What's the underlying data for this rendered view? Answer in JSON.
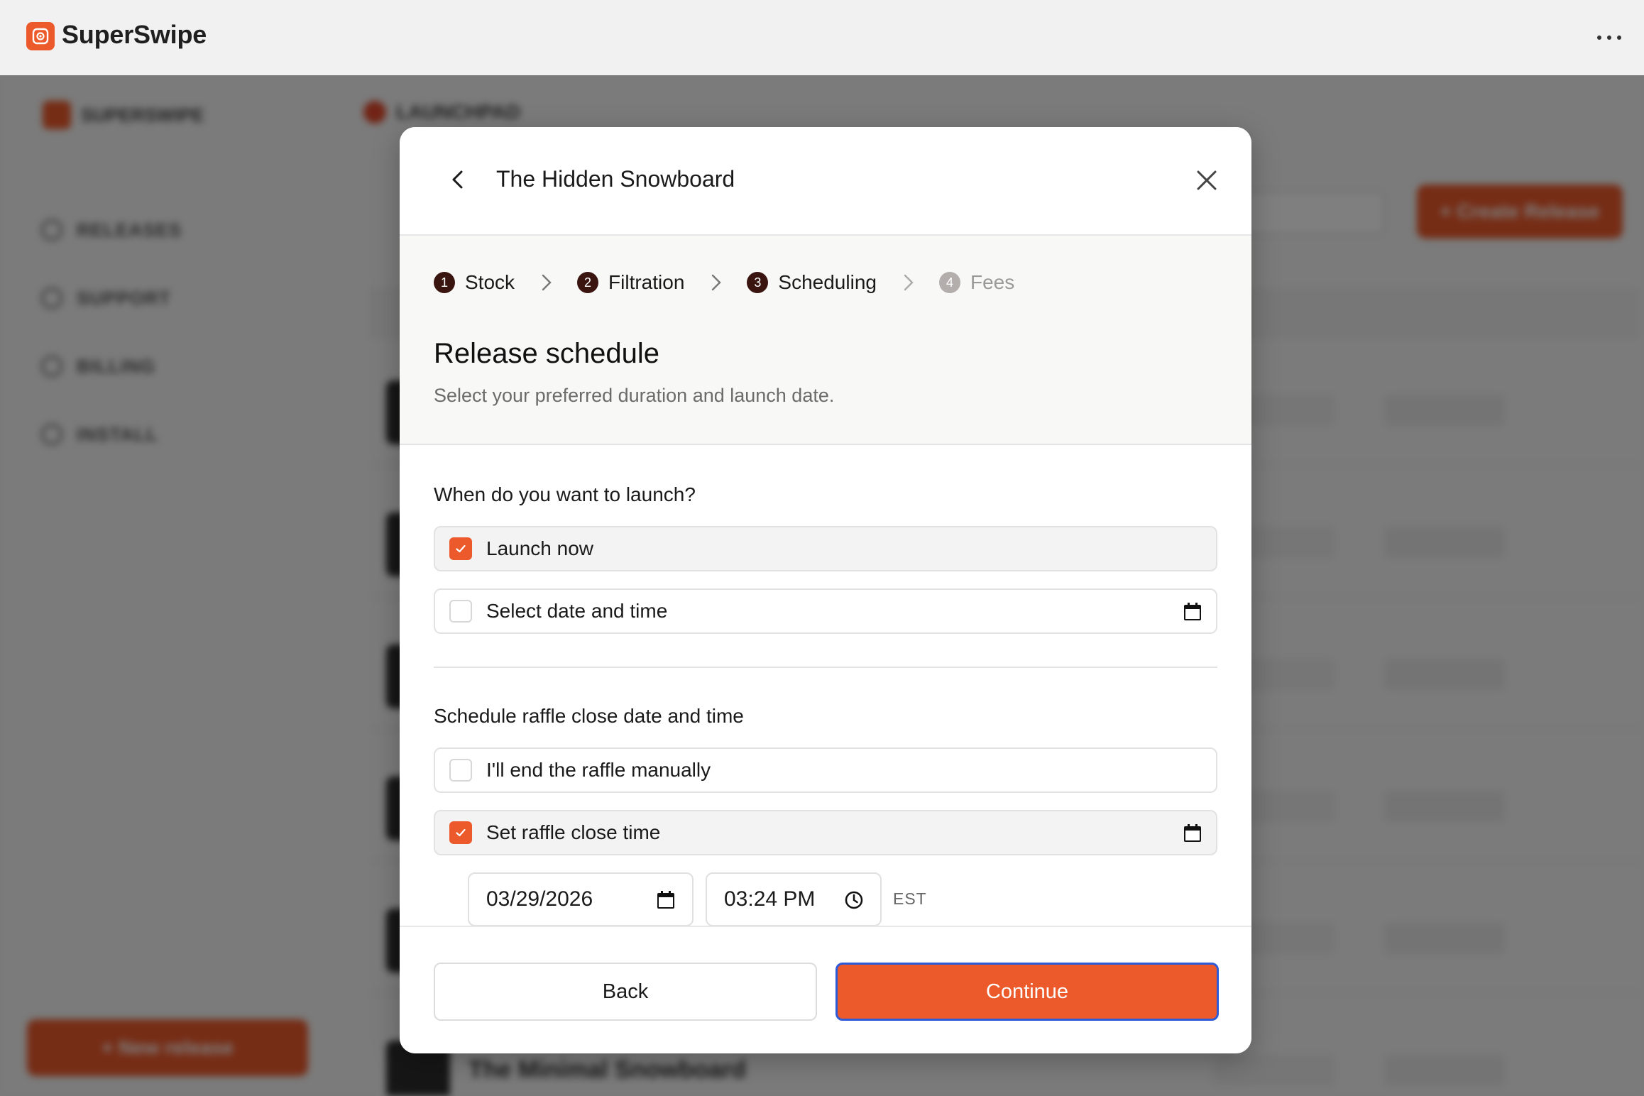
{
  "app": {
    "title": "SuperSwipe",
    "more_icon": "more-horizontal-icon"
  },
  "background": {
    "brand": "SUPERSWIPE",
    "nav": [
      "RELEASES",
      "SUPPORT",
      "BILLING",
      "INSTALL"
    ],
    "new_release": "+ New release",
    "page_header": "LAUNCHPAD",
    "create_release": "+ Create Release",
    "last_row_name": "The Minimal Snowboard"
  },
  "modal": {
    "title": "The Hidden Snowboard",
    "steps": [
      {
        "num": "1",
        "label": "Stock"
      },
      {
        "num": "2",
        "label": "Filtration"
      },
      {
        "num": "3",
        "label": "Scheduling"
      },
      {
        "num": "4",
        "label": "Fees"
      }
    ],
    "section_title": "Release schedule",
    "section_subtitle": "Select your preferred duration and launch date.",
    "launch": {
      "question": "When do you want to launch?",
      "opt_now": "Launch now",
      "opt_now_checked": true,
      "opt_schedule": "Select date and time",
      "opt_schedule_checked": false
    },
    "close": {
      "question": "Schedule raffle close date and time",
      "opt_manual": "I'll end the raffle manually",
      "opt_manual_checked": false,
      "opt_set": "Set raffle close time",
      "opt_set_checked": true,
      "date_value": "03/29/2026",
      "time_value": "03:24 PM",
      "timezone": "EST"
    },
    "buttons": {
      "back": "Back",
      "continue": "Continue"
    }
  },
  "colors": {
    "accent": "#ec5a2b",
    "step_active": "#3a1510",
    "focus_ring": "#2d5bd8"
  }
}
